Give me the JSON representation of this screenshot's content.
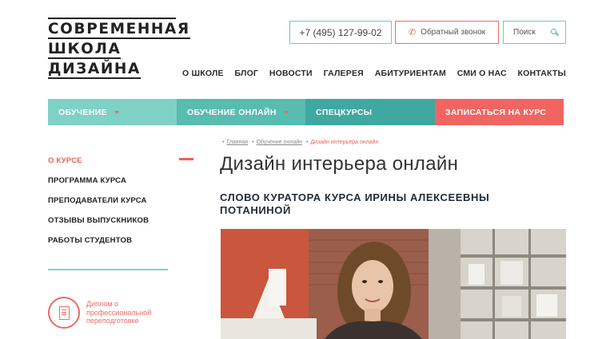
{
  "logo": {
    "line1": "СОВРЕМЕННАЯ",
    "line2": "ШКОЛА",
    "line3": "ДИЗАЙНА"
  },
  "header": {
    "phone": "+7 (495) 127-99-02",
    "callback_label": "Обратный звонок",
    "search_placeholder": "Поиск"
  },
  "topnav": [
    {
      "label": "О ШКОЛЕ"
    },
    {
      "label": "БЛОГ"
    },
    {
      "label": "НОВОСТИ"
    },
    {
      "label": "ГАЛЕРЕЯ"
    },
    {
      "label": "АБИТУРИЕНТАМ"
    },
    {
      "label": "СМИ О НАС"
    },
    {
      "label": "КОНТАКТЫ"
    }
  ],
  "menubar": [
    {
      "label": "ОБУЧЕНИЕ",
      "color": "#7fd1c5"
    },
    {
      "label": "ОБУЧЕНИЕ ОНЛАЙН",
      "color": "#58bcb0"
    },
    {
      "label": "СПЕЦКУРСЫ",
      "color": "#3fa8a0"
    },
    {
      "label": "ЗАПИСАТЬСЯ НА КУРС",
      "color": "#f06561"
    }
  ],
  "sidebar": {
    "items": [
      {
        "label": "О КУРСЕ"
      },
      {
        "label": "ПРОГРАММА КУРСА"
      },
      {
        "label": "ПРЕПОДАВАТЕЛИ КУРСА"
      },
      {
        "label": "ОТЗЫВЫ ВЫПУСКНИКОВ"
      },
      {
        "label": "РАБОТЫ СТУДЕНТОВ"
      }
    ],
    "diploma": "Диплом о профессиональной переподготовке"
  },
  "breadcrumb": {
    "home": "Главная",
    "section": "Обучение онлайн",
    "current": "Дизайн интерьера онлайн"
  },
  "main": {
    "title": "Дизайн интерьера онлайн",
    "subtitle": "СЛОВО КУРАТОРА КУРСА ИРИНЫ АЛЕКСЕЕВНЫ ПОТАНИНОЙ"
  },
  "colors": {
    "accent_teal": "#6ec9bd",
    "accent_red": "#ef5f58"
  }
}
